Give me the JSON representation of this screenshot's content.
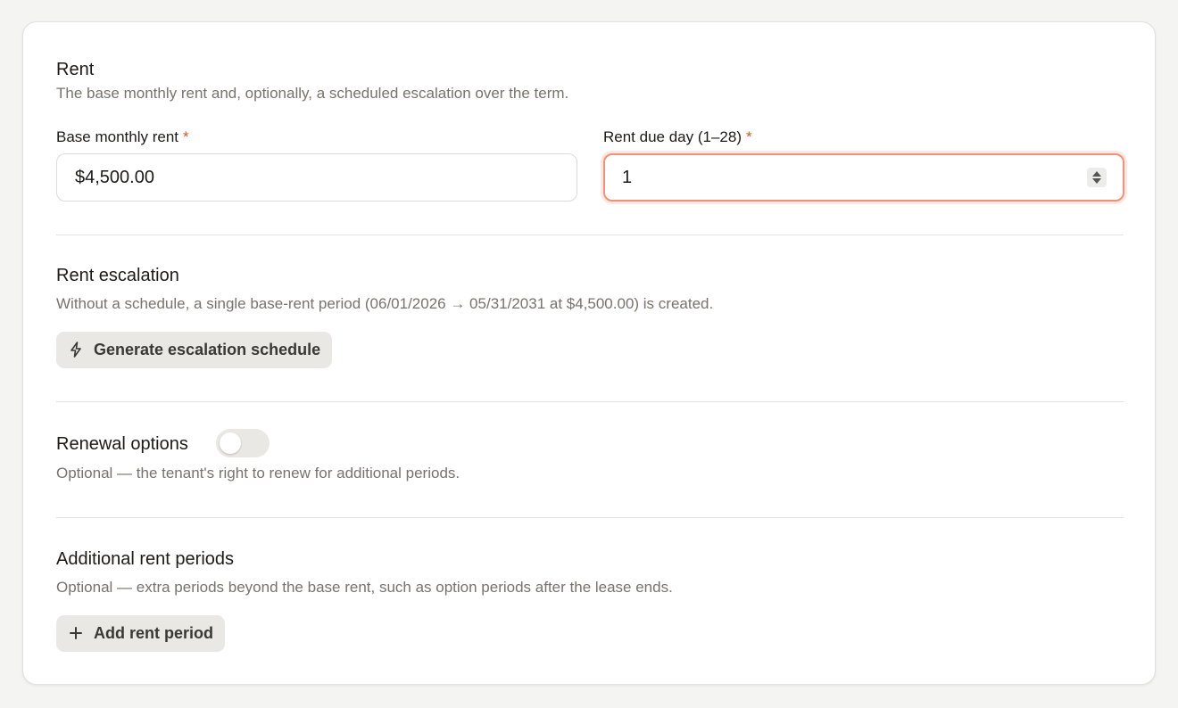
{
  "rent": {
    "title": "Rent",
    "description": "The base monthly rent and, optionally, a scheduled escalation over the term.",
    "base_rent_label": "Base monthly rent",
    "base_rent_value": "$4,500.00",
    "due_day_label": "Rent due day (1–28)",
    "due_day_value": "1",
    "required_marker": "*"
  },
  "escalation": {
    "title": "Rent escalation",
    "description": "Without a schedule, a single base-rent period (06/01/2026 → 05/31/2031 at $4,500.00) is created.",
    "button_label": "Generate escalation schedule",
    "button_icon": "lightning-icon"
  },
  "renewal": {
    "title": "Renewal options",
    "toggle_on": false,
    "description": "Optional — the tenant's right to renew for additional periods."
  },
  "additional": {
    "title": "Additional rent periods",
    "description": "Optional — extra periods beyond the base rent, such as option periods after the lease ends.",
    "button_label": "Add rent period",
    "button_icon": "plus-icon"
  },
  "colors": {
    "required": "#d9542b",
    "focus_ring": "#f39178",
    "muted_text": "#77736d"
  }
}
